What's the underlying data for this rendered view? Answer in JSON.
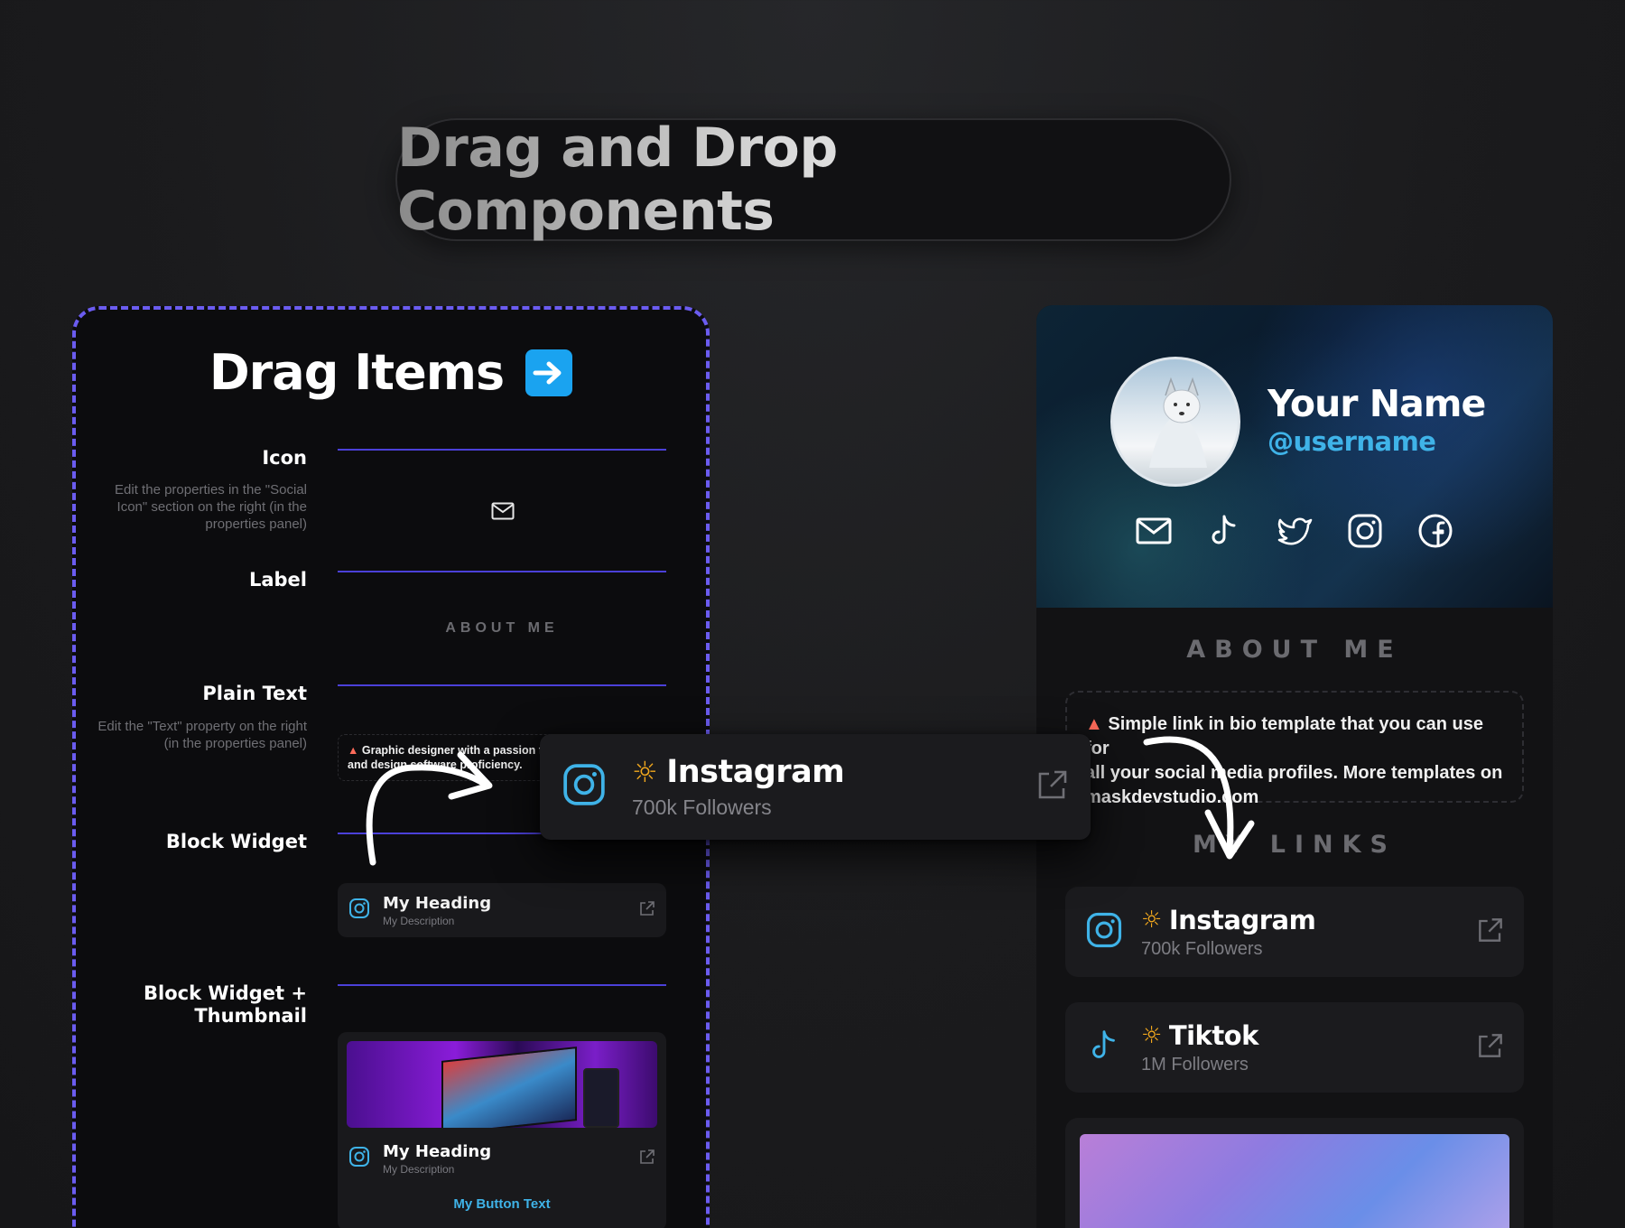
{
  "header": {
    "title": "Drag and Drop Components"
  },
  "drag_panel": {
    "title": "Drag Items",
    "rows": {
      "icon": {
        "label": "Icon",
        "desc": "Edit the properties in the \"Social Icon\" section on the right (in the properties panel)"
      },
      "label": {
        "label": "Label",
        "preview": "ABOUT ME"
      },
      "plain_text": {
        "label": "Plain Text",
        "desc": "Edit the \"Text\" property on the right (in the properties panel)",
        "preview_line1": "Graphic designer with a passion fo",
        "preview_line2": "and design software proficiency."
      },
      "block_widget": {
        "label": "Block Widget",
        "heading": "My Heading",
        "description": "My Description"
      },
      "block_thumb": {
        "label_line1": "Block Widget +",
        "label_line2": "Thumbnail",
        "heading": "My Heading",
        "description": "My Description",
        "button": "My Button Text"
      }
    }
  },
  "floating_card": {
    "title": "Instagram",
    "subtitle": "700k Followers"
  },
  "profile": {
    "name": "Your Name",
    "username": "@username",
    "social_icons": [
      "mail-icon",
      "tiktok-icon",
      "twitter-icon",
      "instagram-icon",
      "facebook-icon"
    ],
    "about_label": "ABOUT ME",
    "bio_line1": "Simple link in bio template that you can use for",
    "bio_line2": "all your social media profiles. More templates on",
    "bio_line3": "maskdevstudio.com",
    "links_label": "MY LINKS",
    "links": [
      {
        "title": "Instagram",
        "subtitle": "700k Followers"
      },
      {
        "title": "Tiktok",
        "subtitle": "1M Followers"
      }
    ]
  },
  "colors": {
    "accent_blue": "#3fb3e8",
    "dash_purple": "#6b5cf0",
    "fire": "#f2a81d"
  }
}
